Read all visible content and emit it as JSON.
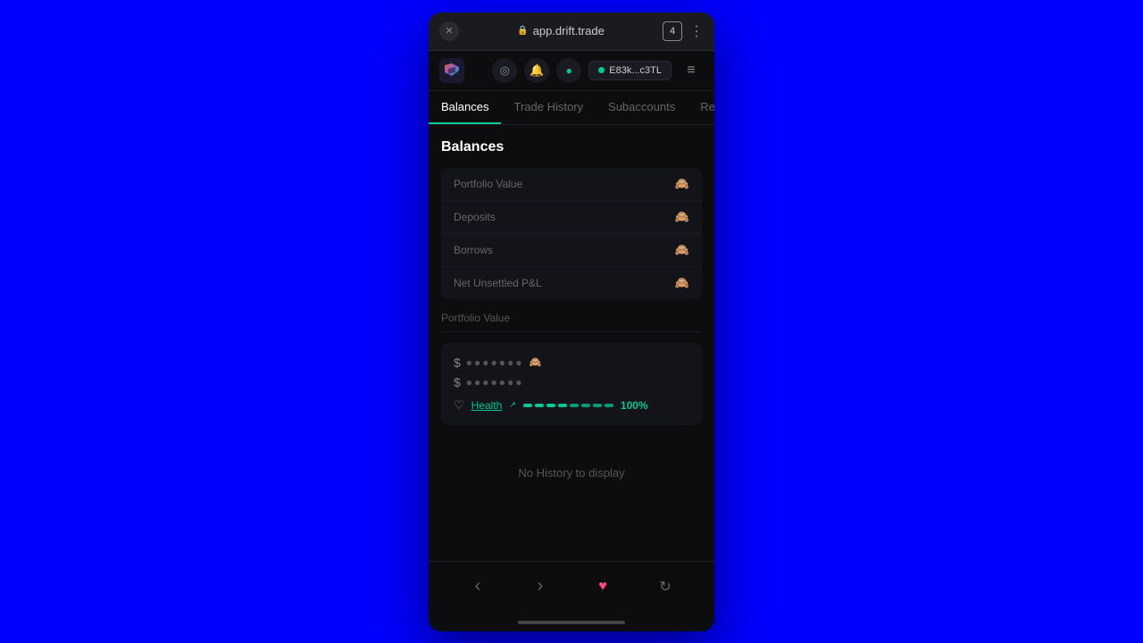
{
  "browser": {
    "url": "app.drift.trade",
    "tab_count": "4",
    "close_label": "✕"
  },
  "header": {
    "wallet_address": "E83k...c3TL",
    "notification_icon": "🔔",
    "search_icon": "⊙"
  },
  "tabs": [
    {
      "id": "balances",
      "label": "Balances",
      "active": true
    },
    {
      "id": "trade-history",
      "label": "Trade History",
      "active": false
    },
    {
      "id": "subaccounts",
      "label": "Subaccounts",
      "active": false
    },
    {
      "id": "ref",
      "label": "Ref",
      "active": false
    }
  ],
  "balances": {
    "section_title": "Balances",
    "rows": [
      {
        "label": "Portfolio Value"
      },
      {
        "label": "Deposits"
      },
      {
        "label": "Borrows"
      },
      {
        "label": "Net Unsettled P&L"
      }
    ]
  },
  "portfolio": {
    "section_title": "Portfolio Value",
    "primary_value_prefix": "$",
    "primary_dots": "●●●●●●●",
    "secondary_prefix": "$",
    "secondary_dots": "●●●●●●●",
    "health_label": "Health",
    "health_pct": "100%",
    "health_segments": [
      "green",
      "green",
      "green",
      "green",
      "green",
      "green",
      "green",
      "green"
    ]
  },
  "no_history": {
    "text": "No History to display"
  },
  "bottom_nav": [
    {
      "id": "back",
      "icon": "‹",
      "label": "back"
    },
    {
      "id": "forward",
      "icon": "›",
      "label": "forward"
    },
    {
      "id": "heart",
      "icon": "♥",
      "label": "favorite",
      "active": true
    },
    {
      "id": "refresh",
      "icon": "↻",
      "label": "refresh"
    }
  ]
}
